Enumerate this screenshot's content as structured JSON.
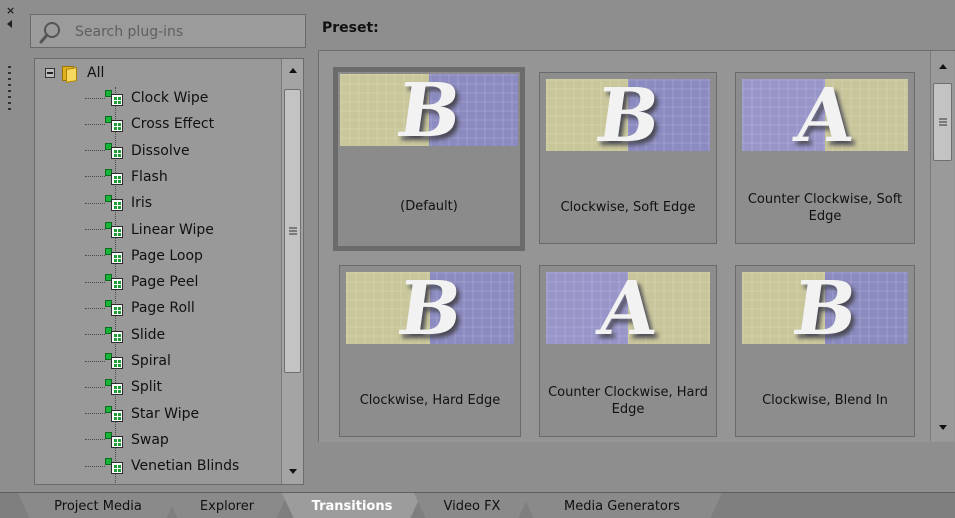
{
  "window": {
    "close_glyph": "×"
  },
  "search": {
    "placeholder": "Search plug-ins",
    "icon": "search-icon"
  },
  "tree": {
    "root_label": "All",
    "items": [
      {
        "label": "Clock Wipe"
      },
      {
        "label": "Cross Effect"
      },
      {
        "label": "Dissolve"
      },
      {
        "label": "Flash"
      },
      {
        "label": "Iris"
      },
      {
        "label": "Linear Wipe"
      },
      {
        "label": "Page Loop"
      },
      {
        "label": "Page Peel"
      },
      {
        "label": "Page Roll"
      },
      {
        "label": "Slide"
      },
      {
        "label": "Spiral"
      },
      {
        "label": "Split"
      },
      {
        "label": "Star Wipe"
      },
      {
        "label": "Swap"
      },
      {
        "label": "Venetian Blinds"
      }
    ]
  },
  "preset": {
    "title": "Preset:",
    "cards": [
      {
        "caption": "(Default)",
        "letter": "B",
        "selected": true
      },
      {
        "caption": "Clockwise, Soft Edge",
        "letter": "B",
        "selected": false
      },
      {
        "caption": "Counter Clockwise, Soft Edge",
        "letter": "A",
        "selected": false
      },
      {
        "caption": "Clockwise, Hard Edge",
        "letter": "B",
        "selected": false
      },
      {
        "caption": "Counter Clockwise, Hard Edge",
        "letter": "A",
        "selected": false
      },
      {
        "caption": "Clockwise, Blend In",
        "letter": "B",
        "selected": false
      }
    ]
  },
  "tabs": [
    {
      "label": "Project Media",
      "active": false
    },
    {
      "label": "Explorer",
      "active": false
    },
    {
      "label": "Transitions",
      "active": true
    },
    {
      "label": "Video FX",
      "active": false
    },
    {
      "label": "Media Generators",
      "active": false
    }
  ],
  "colors": {
    "panel_bg": "#8e8e8e",
    "tree_bg": "#999999",
    "thumb_yellow": "#c9c79a",
    "thumb_purple": "#8c8bc1",
    "active_tab_text": "#ffffff"
  }
}
